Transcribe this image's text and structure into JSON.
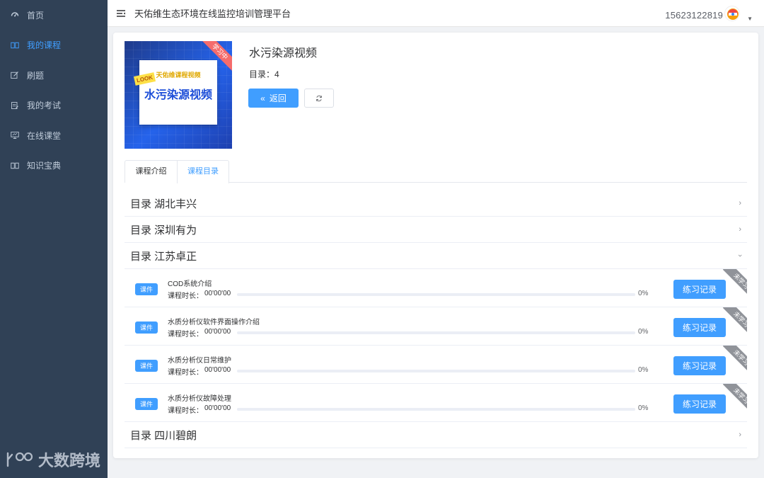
{
  "sidebar": {
    "items": [
      {
        "label": "首页",
        "icon": "dashboard-icon",
        "active": false
      },
      {
        "label": "我的课程",
        "icon": "book-icon",
        "active": true
      },
      {
        "label": "刷题",
        "icon": "edit-icon",
        "active": false
      },
      {
        "label": "我的考试",
        "icon": "exam-icon",
        "active": false
      },
      {
        "label": "在线课堂",
        "icon": "monitor-icon",
        "active": false
      },
      {
        "label": "知识宝典",
        "icon": "book-open-icon",
        "active": false
      }
    ],
    "brand": "大数跨境"
  },
  "header": {
    "title": "天佑维生态环境在线监控培训管理平台",
    "user_phone": "15623122819"
  },
  "course": {
    "cover_subtitle": "天佑维课程视频",
    "cover_title": "水污染源视频",
    "cover_look": "LOOK",
    "cover_ribbon": "学习中",
    "title": "水污染源视频",
    "count_label": "目录：4",
    "back_label": "返回"
  },
  "tabs": [
    "课程介绍",
    "课程目录"
  ],
  "catalog": {
    "sections": [
      {
        "title": "目录 湖北丰兴",
        "expanded": false
      },
      {
        "title": "目录 深圳有为",
        "expanded": false
      },
      {
        "title": "目录 江苏卓正",
        "expanded": true
      },
      {
        "title": "目录 四川碧朗",
        "expanded": false
      }
    ],
    "lessons": [
      {
        "tag": "课件",
        "name": "COD系统介绍",
        "duration_label": "课程时长：",
        "duration": "00'00'00",
        "progress": "0%",
        "progress_value": 0,
        "button": "练习记录",
        "status": "未学习"
      },
      {
        "tag": "课件",
        "name": "水质分析仪软件界面操作介绍",
        "duration_label": "课程时长：",
        "duration": "00'00'00",
        "progress": "0%",
        "progress_value": 0,
        "button": "练习记录",
        "status": "未学习"
      },
      {
        "tag": "课件",
        "name": "水质分析仪日常维护",
        "duration_label": "课程时长：",
        "duration": "00'00'00",
        "progress": "0%",
        "progress_value": 0,
        "button": "练习记录",
        "status": "未学习"
      },
      {
        "tag": "课件",
        "name": "水质分析仪故障处理",
        "duration_label": "课程时长：",
        "duration": "00'00'00",
        "progress": "0%",
        "progress_value": 0,
        "button": "练习记录",
        "status": "未学习"
      }
    ]
  },
  "colors": {
    "sidebar_bg": "#304156",
    "primary": "#409eff",
    "ribbon_red": "#f56c6c",
    "status_grey": "#909399"
  }
}
